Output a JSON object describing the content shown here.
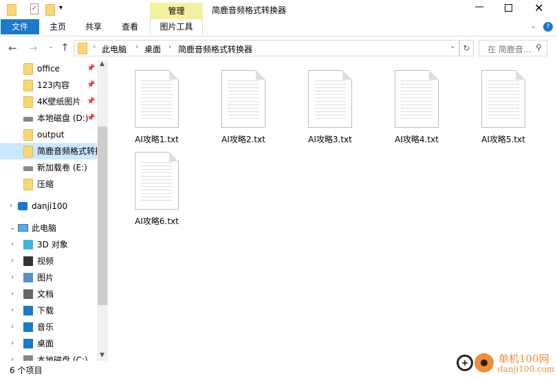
{
  "window": {
    "title": "简鹿音频格式转换器",
    "contextual_tab": "管理"
  },
  "ribbon": {
    "tabs": [
      "文件",
      "主页",
      "共享",
      "查看",
      "图片工具"
    ]
  },
  "address": {
    "path": [
      "此电脑",
      "桌面",
      "简鹿音频格式转换器"
    ],
    "search_placeholder": "在 简鹿音..."
  },
  "nav": {
    "quick": [
      {
        "label": "office",
        "icon": "folder",
        "pinned": true
      },
      {
        "label": "123内容",
        "icon": "folder",
        "pinned": true
      },
      {
        "label": "4K壁纸图片",
        "icon": "folder",
        "pinned": true
      },
      {
        "label": "本地磁盘 (D:)",
        "icon": "drive",
        "pinned": true
      },
      {
        "label": "output",
        "icon": "folder"
      },
      {
        "label": "简鹿音频格式转换器",
        "icon": "folder",
        "selected": true
      },
      {
        "label": "新加载卷 (E:)",
        "icon": "drive"
      },
      {
        "label": "压缩",
        "icon": "folder"
      }
    ],
    "danji": "danji100",
    "pc": "此电脑",
    "pc_items": [
      "3D 对象",
      "视频",
      "图片",
      "文档",
      "下载",
      "音乐",
      "桌面",
      "本地磁盘 (C:)"
    ]
  },
  "files": [
    "AI攻略1.txt",
    "AI攻略2.txt",
    "AI攻略3.txt",
    "AI攻略4.txt",
    "AI攻略5.txt",
    "AI攻略6.txt"
  ],
  "status": {
    "count": "6 个项目"
  },
  "watermark": {
    "text": "单机100网",
    "url": "danji100.com"
  },
  "colors": {
    "accent": "#1979ca",
    "selected": "#cce8ff",
    "manage_tab": "#f3f19f"
  }
}
